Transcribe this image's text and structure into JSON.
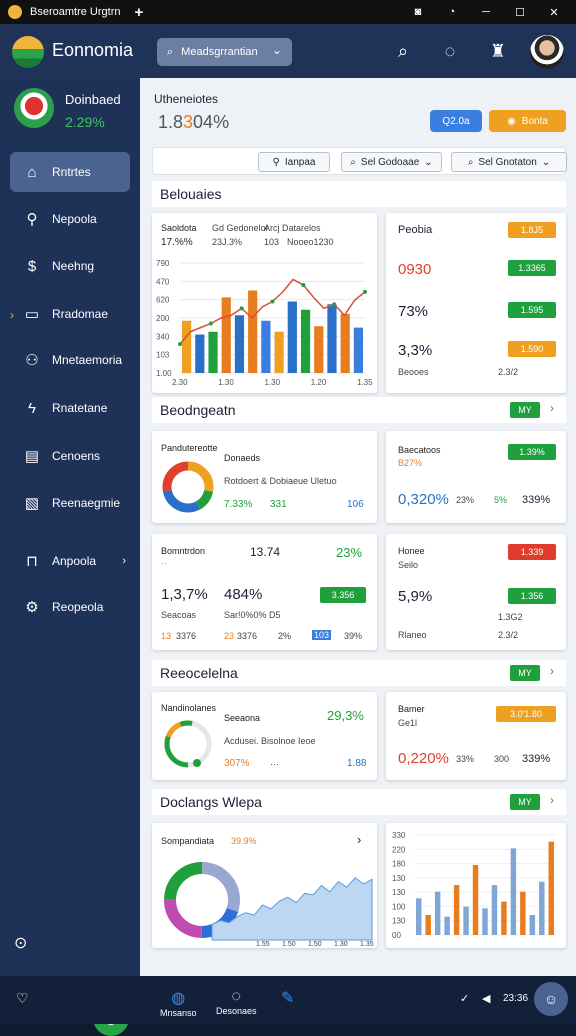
{
  "window": {
    "title": "Bseroamtre Urgtrn",
    "plus": "+"
  },
  "app": {
    "name": "Eonnomia"
  },
  "search": {
    "label": "Meadsgrrantian"
  },
  "user": {
    "name": "Doinbaed",
    "pct": "2.29%"
  },
  "nav": [
    {
      "label": "Rntrtes",
      "icon": "home-icon"
    },
    {
      "label": "Nepoola",
      "icon": "search-icon"
    },
    {
      "label": "Neehng",
      "icon": "dollar-icon"
    },
    {
      "label": "Rradomae",
      "icon": "folder-icon"
    },
    {
      "label": "Mnetaemoria",
      "icon": "users-icon"
    },
    {
      "label": "Rnatetane",
      "icon": "bolt-icon"
    },
    {
      "label": "Cenoens",
      "icon": "document-icon"
    },
    {
      "label": "Reenaegmie",
      "icon": "chart-icon"
    },
    {
      "label": "Anpoola",
      "icon": "lock-icon"
    },
    {
      "label": "Reopeola",
      "icon": "gear-icon"
    }
  ],
  "header": {
    "title": "Utheneiotes",
    "value_main": "1.8",
    "value_accent": "3",
    "value_rest": "04%",
    "btn_blue": "Q2.0a",
    "btn_orange": "Bonta"
  },
  "filters": [
    "Ianpaa",
    "Sel Godoaae",
    "Sel Gnotaton"
  ],
  "sections": {
    "s1": "Belouaies",
    "s2": "Beodngeatn",
    "s3": "Reeocelelna",
    "s4": "Doclangs Wlepa"
  },
  "card1": {
    "lbl1": "Saoldota",
    "lbl2": "Gd Gedonelor",
    "lbl3": "Arcj Datarelos",
    "v1": "17.%%",
    "v2": "23J.3%",
    "v3": "103",
    "v4": "Nooeo1230"
  },
  "card2": {
    "title": "Peobia",
    "pill1": "1.8J5",
    "v1": "0930",
    "pill2": "1.3365",
    "v2": "73%",
    "pill3": "1.595",
    "v3": "3,3%",
    "pill4": "1.590",
    "foot1": "Beooes",
    "foot2": "2.3/2"
  },
  "see_all": "MY",
  "card3": {
    "title": "Pandutereotte",
    "sub": "Donaeds",
    "desc": "Rotdoert & Dobiaeue Uletuo",
    "v1": "7.33%",
    "v2": "331",
    "v3": "106"
  },
  "card4": {
    "title": "Baecatoos",
    "sub": "B27%",
    "pill": "1.39%",
    "v1": "0,320%",
    "v2": "23%",
    "v3": "5%",
    "v4": "339%"
  },
  "card5": {
    "title": "Bomntrdon",
    "v1": "13.74",
    "v2": "23%",
    "v3": "1,3,7%",
    "v4": "484%",
    "pill": "3.356",
    "lbl1": "Seacoas",
    "lbl2": "Sar!0%0% D5",
    "f1": "13",
    "f2": "3376",
    "f3": "23",
    "f4": "3376",
    "f5": "2%",
    "f6": "103",
    "f7": "39%"
  },
  "card6": {
    "title": "Honee",
    "sub": "Seilo",
    "pill1": "1.339",
    "v1": "5,9%",
    "pill2": "1.356",
    "f1": "1.3G2",
    "f2": "Rlaneo",
    "f3": "2.3/2"
  },
  "card7": {
    "title": "Nandinolanes",
    "sub": "Seeaona",
    "pct": "29,3%",
    "desc": "Acdusei. Bisolnoe Ieoe",
    "v1": "307%",
    "v2": "1.88",
    "dots": "···"
  },
  "card8": {
    "title": "Bamer",
    "sub": "Ge1l",
    "pill": "3.0'1.80",
    "v1": "0,220%",
    "v2": "33%",
    "v3": "300",
    "v4": "339%"
  },
  "card9": {
    "title": "Sompandiata",
    "pct": "39.9%"
  },
  "card1_xticks": [
    "2.30",
    "1.30",
    "1.30",
    "1.20",
    "1.35"
  ],
  "card9_xticks": [
    "1.55",
    "1.50",
    "1.50",
    "1.30",
    "1.35"
  ],
  "card1_yticks": [
    "790",
    "470",
    "620",
    "200",
    "340",
    "103",
    "1.00"
  ],
  "card10_yticks": [
    "330",
    "220",
    "180",
    "130",
    "130",
    "100",
    "130",
    "00"
  ],
  "tabs": [
    {
      "label": "Mnsanso",
      "icon": "globe-icon"
    },
    {
      "label": "Desonaes",
      "icon": "chat-icon"
    },
    {
      "label": "",
      "icon": "pen-icon"
    }
  ],
  "tray": {
    "time": "23:36"
  },
  "chart_data": [
    {
      "type": "bar",
      "values": [
        380,
        280,
        300,
        550,
        420,
        600,
        380,
        300,
        520,
        460,
        340,
        500,
        430,
        330
      ],
      "line": [
        210,
        300,
        330,
        360,
        400,
        420,
        470,
        400,
        480,
        520,
        590,
        680,
        640,
        550,
        470,
        500,
        420,
        530,
        590
      ]
    },
    {
      "type": "pie",
      "values": [
        28,
        14,
        30,
        28
      ]
    },
    {
      "type": "area",
      "values": [
        20,
        25,
        22,
        30,
        35,
        32,
        45,
        40,
        50,
        55,
        48,
        60,
        58,
        70,
        62,
        75,
        68,
        80,
        72,
        78
      ]
    },
    {
      "type": "bar",
      "values": [
        220,
        120,
        260,
        110,
        300,
        170,
        420,
        160,
        300,
        200,
        520,
        260,
        120,
        320,
        560
      ]
    }
  ]
}
